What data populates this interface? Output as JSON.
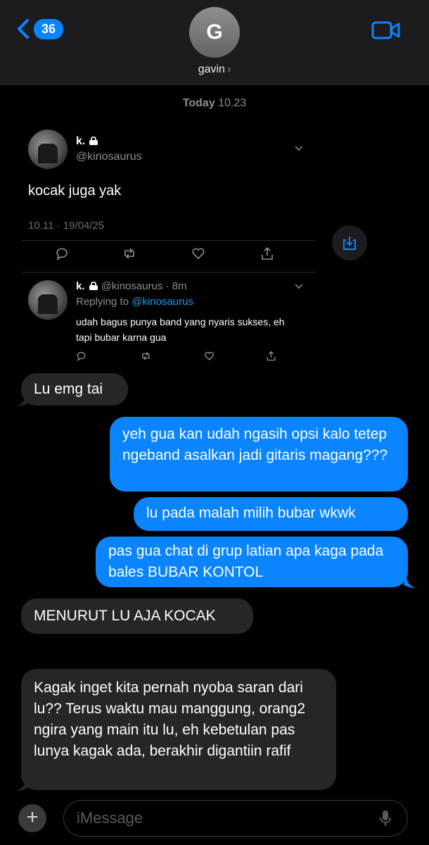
{
  "header": {
    "back_count": "36",
    "avatar_initial": "G",
    "contact_name": "gavin",
    "name_chevron": "›"
  },
  "timestamp": {
    "day": "Today",
    "time": "10.23"
  },
  "tweet": {
    "name": "k.",
    "handle": "@kinosaurus",
    "text": "kocak juga yak",
    "meta": "10.11 · 19/04/25",
    "reply": {
      "name": "k.",
      "handle_time": "@kinosaurus · 8m",
      "replying_prefix": "Replying to",
      "replying_to": "@kinosaurus",
      "text": "udah bagus punya band yang nyaris sukses, eh tapi bubar karna gua"
    }
  },
  "messages": [
    {
      "dir": "in",
      "text": "Lu emg tai"
    },
    {
      "dir": "out",
      "text": "yeh gua kan udah ngasih opsi kalo tetep ngeband asalkan jadi gitaris magang???"
    },
    {
      "dir": "out",
      "text": "lu pada malah milih bubar wkwk"
    },
    {
      "dir": "out",
      "text": "pas gua chat di grup latian apa kaga pada bales BUBAR KONTOL"
    },
    {
      "dir": "in",
      "text": "MENURUT LU AJA KOCAK"
    },
    {
      "dir": "in",
      "text": "Kagak inget kita pernah nyoba saran dari lu?? Terus waktu mau manggung, orang2 ngira yang main itu lu, eh kebetulan pas lunya kagak ada, berakhir digantiin rafif"
    }
  ],
  "input": {
    "placeholder": "iMessage",
    "plus": "+"
  },
  "colors": {
    "accent": "#0a84ff",
    "incoming": "#262629",
    "link": "#1d9bf0"
  }
}
